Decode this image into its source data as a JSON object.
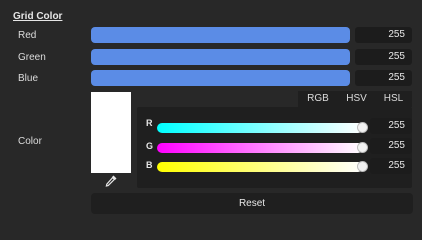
{
  "section": {
    "title": "Grid Color"
  },
  "rows": [
    {
      "label": "Red",
      "value": "255"
    },
    {
      "label": "Green",
      "value": "255"
    },
    {
      "label": "Blue",
      "value": "255"
    }
  ],
  "color": {
    "label": "Color",
    "swatch_hex": "#ffffff",
    "bar_color": "#5b8ce6",
    "eyedropper_icon": "eyedropper-icon"
  },
  "tabs": [
    {
      "label": "RGB",
      "active": false
    },
    {
      "label": "HSV",
      "active": false
    },
    {
      "label": "HSL",
      "active": false
    }
  ],
  "channels": [
    {
      "label": "R",
      "value": "255",
      "level": 1.0,
      "gradient": [
        "#00ffff",
        "#ffffff"
      ]
    },
    {
      "label": "G",
      "value": "255",
      "level": 1.0,
      "gradient": [
        "#ff00ff",
        "#ffffff"
      ]
    },
    {
      "label": "B",
      "value": "255",
      "level": 1.0,
      "gradient": [
        "#ffff00",
        "#ffffff"
      ]
    }
  ],
  "reset_label": "Reset"
}
